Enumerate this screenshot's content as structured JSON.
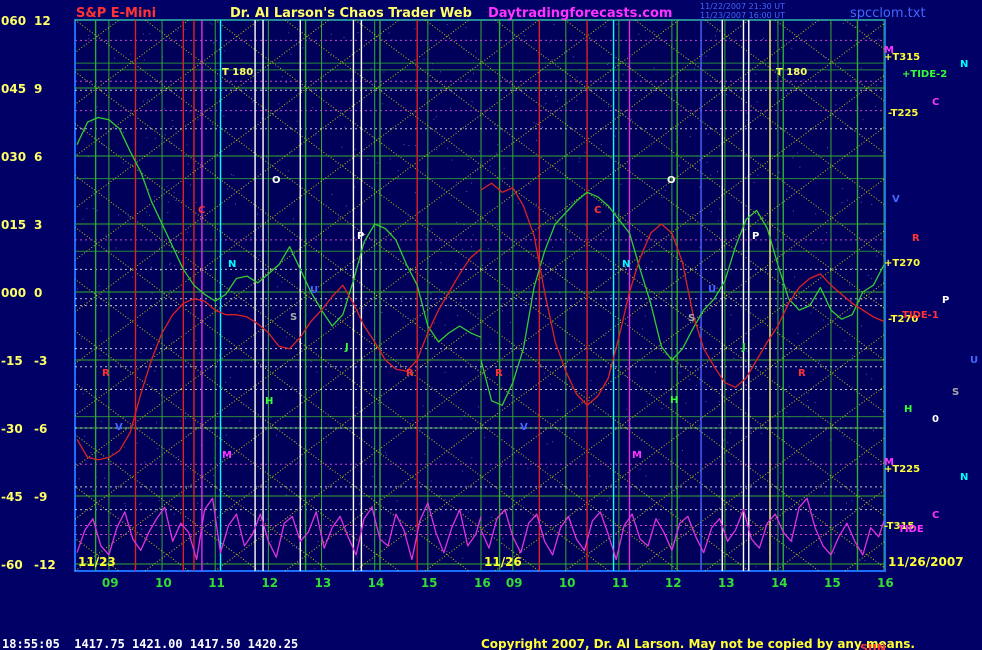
{
  "colors": {
    "background": "#000066",
    "plot_background": "#00005a",
    "frame": "#1a6cff",
    "grid_green": "#33aa33",
    "diagonal_yellow": "#e6e600",
    "dashed_white": "#ffffff",
    "dashed_magenta": "#cc44cc",
    "price_green": "#33cc33",
    "tide_red": "#dd2222",
    "tide_magenta": "#dd33dd",
    "header_red": "#ff3333",
    "header_yellow": "#ffff66",
    "header_magenta": "#ff33ff",
    "header_blue": "#4466ff",
    "footer_white": "#ffffff",
    "footer_yellow": "#ffff33"
  },
  "header": {
    "left_label": "S&P E-Mini",
    "title": "Dr. Al Larson's Chaos Trader Web",
    "site": "Daytradingforecasts.com",
    "file": "spcclom.txt",
    "stamp_line1": "11/22/2007 21:30 UT",
    "stamp_line2": "11/23/2007 16:00 UT"
  },
  "footer": {
    "quote": "18:55:05  1417.75 1421.00 1417.50 1420.25",
    "copyright": "Copyright 2007, Dr. Al Larson. May not be copied by any means.",
    "stray": "SUN"
  },
  "chart_data": {
    "type": "line",
    "title": "S&P E-Mini",
    "y_axis_left": {
      "degrees": [
        "060",
        "045",
        "030",
        "015",
        "000",
        "-15",
        "-30",
        "-45",
        "-60"
      ],
      "points": [
        "12",
        "9",
        "6",
        "3",
        "0",
        "-3",
        "-6",
        "-9",
        "-12"
      ],
      "range": [
        -12,
        12
      ]
    },
    "x_axis": {
      "ticks": [
        "09",
        "10",
        "11",
        "12",
        "13",
        "14",
        "15",
        "16",
        "09",
        "10",
        "11",
        "12",
        "13",
        "14",
        "15",
        "16"
      ],
      "session_labels": [
        "11/23",
        "11/26",
        "11/26/2007"
      ]
    },
    "right_labels": [
      {
        "text": "M",
        "color": "#ff33ff"
      },
      {
        "text": "+T315",
        "color": "#ffff33"
      },
      {
        "text": "N",
        "color": "#00ffff"
      },
      {
        "text": "+TIDE-2",
        "color": "#33ff33"
      },
      {
        "text": "C",
        "color": "#ff33ff"
      },
      {
        "text": "-T225",
        "color": "#ffff33"
      },
      {
        "text": "V",
        "color": "#4466ff"
      },
      {
        "text": "R",
        "color": "#ff3333"
      },
      {
        "text": "+T270",
        "color": "#ffff33"
      },
      {
        "text": "P",
        "color": "#ffffff"
      },
      {
        "text": "-T270",
        "color": "#ffff33"
      },
      {
        "text": "TIDE-1",
        "color": "#ff3333"
      },
      {
        "text": "U",
        "color": "#4466ff"
      },
      {
        "text": "S",
        "color": "#aaaaaa"
      },
      {
        "text": "H",
        "color": "#33ff33"
      },
      {
        "text": "0",
        "color": "#ffffff"
      },
      {
        "text": "M",
        "color": "#ff33ff"
      },
      {
        "text": "+T225",
        "color": "#ffff33"
      },
      {
        "text": "N",
        "color": "#00ffff"
      },
      {
        "text": "C",
        "color": "#ff33ff"
      },
      {
        "text": "-T315",
        "color": "#ffff33"
      },
      {
        "text": "TIDE",
        "color": "#ff33ff"
      }
    ],
    "plot_markers": [
      {
        "text": "T 180",
        "color": "#ffff66"
      },
      {
        "text": "T 180",
        "color": "#ffff66"
      },
      {
        "text": "O",
        "color": "#ffffff"
      },
      {
        "text": "O",
        "color": "#ffffff"
      },
      {
        "text": "C",
        "color": "#ff3333"
      },
      {
        "text": "C",
        "color": "#ff3333"
      },
      {
        "text": "N",
        "color": "#00ffff"
      },
      {
        "text": "N",
        "color": "#00ffff"
      },
      {
        "text": "P",
        "color": "#ffffff"
      },
      {
        "text": "P",
        "color": "#ffffff"
      },
      {
        "text": "S",
        "color": "#aaaaaa"
      },
      {
        "text": "S",
        "color": "#aaaaaa"
      },
      {
        "text": "R",
        "color": "#ff3333"
      },
      {
        "text": "R",
        "color": "#ff3333"
      },
      {
        "text": "R",
        "color": "#ff3333"
      },
      {
        "text": "R",
        "color": "#ff3333"
      },
      {
        "text": "H",
        "color": "#33ff33"
      },
      {
        "text": "H",
        "color": "#33ff33"
      },
      {
        "text": "M",
        "color": "#ff33ff"
      },
      {
        "text": "M",
        "color": "#ff33ff"
      },
      {
        "text": "U",
        "color": "#4466ff"
      },
      {
        "text": "U",
        "color": "#4466ff"
      },
      {
        "text": "V",
        "color": "#4466ff"
      },
      {
        "text": "V",
        "color": "#4466ff"
      },
      {
        "text": "J",
        "color": "#33ff33"
      },
      {
        "text": "J",
        "color": "#33ff33"
      }
    ],
    "session_starts": [
      8.4,
      8.4
    ],
    "vertical_lines": [
      {
        "x": 8.75,
        "color": "#33aa33",
        "session": 0
      },
      {
        "x": 9.5,
        "color": "#dd2222",
        "session": 0
      },
      {
        "x": 10.4,
        "color": "#dd2222",
        "session": 0
      },
      {
        "x": 10.6,
        "color": "#dd2222",
        "session": 0
      },
      {
        "x": 10.75,
        "color": "#dd33dd",
        "session": 0
      },
      {
        "x": 11.1,
        "color": "#00ffff",
        "session": 0
      },
      {
        "x": 11.75,
        "color": "#ffffff",
        "session": 0
      },
      {
        "x": 11.9,
        "color": "#ffffff",
        "session": 0
      },
      {
        "x": 12.6,
        "color": "#ffffff",
        "session": 0
      },
      {
        "x": 12.7,
        "color": "#33aa33",
        "session": 0
      },
      {
        "x": 13.6,
        "color": "#ffffff",
        "session": 0
      },
      {
        "x": 13.75,
        "color": "#ffffff",
        "session": 0
      },
      {
        "x": 14.1,
        "color": "#33aa33",
        "session": 0
      },
      {
        "x": 14.8,
        "color": "#dd2222",
        "session": 0
      },
      {
        "x": 8.75,
        "color": "#33aa33",
        "session": 1
      },
      {
        "x": 9.5,
        "color": "#dd2222",
        "session": 1
      },
      {
        "x": 10.4,
        "color": "#dd2222",
        "session": 1
      },
      {
        "x": 10.9,
        "color": "#00ffff",
        "session": 1
      },
      {
        "x": 11.2,
        "color": "#dd33dd",
        "session": 1
      },
      {
        "x": 12.1,
        "color": "#33aa33",
        "session": 1
      },
      {
        "x": 12.55,
        "color": "#4466ff",
        "session": 1
      },
      {
        "x": 12.95,
        "color": "#ffffff",
        "session": 1
      },
      {
        "x": 13.35,
        "color": "#ffffff",
        "session": 1
      },
      {
        "x": 13.45,
        "color": "#ffffff",
        "session": 1
      },
      {
        "x": 13.85,
        "color": "#ffff66",
        "session": 1
      },
      {
        "x": 14.1,
        "color": "#33aa33",
        "session": 1
      },
      {
        "x": 15.5,
        "color": "#33aa33",
        "session": 1
      }
    ],
    "hlines_white": [
      8.9,
      7.2,
      1.0,
      -0.3,
      -0.6,
      -2.5,
      -3.3,
      -4.3,
      -6.0,
      -8.6,
      -9.6
    ],
    "hlines_magenta": [
      11.1,
      9.3,
      8.0,
      2.3,
      -7.6,
      -10.3,
      -10.7
    ],
    "hlines_green": [
      10.1,
      9.8,
      5.0,
      1.8,
      -5.5
    ],
    "series": [
      {
        "name": "Price",
        "color": "#33cc33",
        "session": 0,
        "x": [
          8.4,
          8.6,
          8.8,
          9.0,
          9.2,
          9.4,
          9.6,
          9.8,
          10.0,
          10.2,
          10.4,
          10.6,
          10.8,
          11.0,
          11.2,
          11.4,
          11.6,
          11.8,
          12.0,
          12.2,
          12.4,
          12.6,
          12.8,
          13.0,
          13.2,
          13.4,
          13.6,
          13.8,
          14.0,
          14.2,
          14.4,
          14.6,
          14.8,
          15.0,
          15.2,
          15.4,
          15.6,
          15.8,
          16.0
        ],
        "y": [
          6.5,
          7.5,
          7.7,
          7.6,
          7.2,
          6.2,
          5.3,
          4.0,
          3.0,
          2.0,
          1.0,
          0.3,
          -0.1,
          -0.4,
          -0.1,
          0.6,
          0.7,
          0.4,
          0.8,
          1.2,
          2.0,
          1.0,
          0.0,
          -0.8,
          -1.5,
          -1.0,
          0.5,
          2.2,
          3.0,
          2.8,
          2.3,
          1.2,
          0.3,
          -1.5,
          -2.2,
          -1.8,
          -1.5,
          -1.8,
          -2.0
        ]
      },
      {
        "name": "Price",
        "color": "#33cc33",
        "session": 1,
        "x": [
          8.4,
          8.6,
          8.8,
          9.0,
          9.2,
          9.4,
          9.6,
          9.8,
          10.0,
          10.2,
          10.4,
          10.6,
          10.8,
          11.0,
          11.2,
          11.4,
          11.6,
          11.8,
          12.0,
          12.2,
          12.4,
          12.6,
          12.8,
          13.0,
          13.2,
          13.4,
          13.6,
          13.8,
          14.0,
          14.2,
          14.4,
          14.6,
          14.8,
          15.0,
          15.2,
          15.4,
          15.6,
          15.8,
          16.0
        ],
        "y": [
          -3.0,
          -4.8,
          -5.0,
          -4.0,
          -2.5,
          0.2,
          1.8,
          3.0,
          3.5,
          4.0,
          4.4,
          4.2,
          3.8,
          3.2,
          2.6,
          1.0,
          -0.5,
          -2.4,
          -3.0,
          -2.5,
          -1.6,
          -0.8,
          -0.3,
          0.5,
          2.0,
          3.2,
          3.6,
          2.8,
          1.2,
          -0.3,
          -0.8,
          -0.6,
          0.2,
          -0.8,
          -1.2,
          -1.0,
          0.0,
          0.3,
          1.2
        ]
      },
      {
        "name": "TIDE-1",
        "color": "#dd2222",
        "session": 0,
        "x": [
          8.4,
          8.6,
          8.8,
          9.0,
          9.2,
          9.4,
          9.6,
          9.8,
          10.0,
          10.2,
          10.4,
          10.6,
          10.8,
          11.0,
          11.2,
          11.4,
          11.6,
          11.8,
          12.0,
          12.2,
          12.4,
          12.6,
          12.8,
          13.0,
          13.2,
          13.4,
          13.6,
          13.8,
          14.0,
          14.2,
          14.4,
          14.6,
          14.8,
          15.0,
          15.2,
          15.4,
          15.6,
          15.8,
          16.0
        ],
        "y": [
          -6.5,
          -7.3,
          -7.4,
          -7.3,
          -7.0,
          -6.2,
          -4.5,
          -3.0,
          -1.8,
          -1.0,
          -0.5,
          -0.3,
          -0.4,
          -0.8,
          -1.0,
          -1.0,
          -1.1,
          -1.4,
          -1.8,
          -2.4,
          -2.5,
          -2.0,
          -1.3,
          -0.8,
          -0.2,
          0.3,
          -0.5,
          -1.5,
          -2.2,
          -3.0,
          -3.4,
          -3.5,
          -3.0,
          -1.8,
          -0.8,
          0.0,
          0.8,
          1.5,
          1.9
        ]
      },
      {
        "name": "TIDE-1",
        "color": "#dd2222",
        "session": 1,
        "x": [
          8.4,
          8.6,
          8.8,
          9.0,
          9.2,
          9.4,
          9.6,
          9.8,
          10.0,
          10.2,
          10.4,
          10.6,
          10.8,
          11.0,
          11.2,
          11.4,
          11.6,
          11.8,
          12.0,
          12.2,
          12.4,
          12.6,
          12.8,
          13.0,
          13.2,
          13.4,
          13.6,
          13.8,
          14.0,
          14.2,
          14.4,
          14.6,
          14.8,
          15.0,
          15.2,
          15.4,
          15.6,
          15.8,
          16.0
        ],
        "y": [
          4.5,
          4.8,
          4.4,
          4.6,
          3.8,
          2.5,
          0.0,
          -2.2,
          -3.5,
          -4.5,
          -5.0,
          -4.6,
          -3.8,
          -2.0,
          0.0,
          1.5,
          2.6,
          3.0,
          2.6,
          1.3,
          -1.0,
          -2.5,
          -3.3,
          -4.0,
          -4.2,
          -3.8,
          -3.0,
          -2.2,
          -1.5,
          -0.5,
          0.2,
          0.6,
          0.8,
          0.3,
          -0.1,
          -0.5,
          -0.8,
          -1.1,
          -1.3
        ]
      },
      {
        "name": "TIDE",
        "color": "#dd33dd",
        "session": 0,
        "x": [
          8.4,
          8.55,
          8.7,
          8.85,
          9.0,
          9.15,
          9.3,
          9.45,
          9.6,
          9.75,
          9.9,
          10.05,
          10.2,
          10.35,
          10.5,
          10.65,
          10.8,
          10.95,
          11.1,
          11.25,
          11.4,
          11.55,
          11.7,
          11.85,
          12.0,
          12.15,
          12.3,
          12.45,
          12.6,
          12.75,
          12.9,
          13.05,
          13.2,
          13.35,
          13.5,
          13.65,
          13.8,
          13.95,
          14.1,
          14.25,
          14.4,
          14.55,
          14.7,
          14.85,
          15.0,
          15.15,
          15.3,
          15.45,
          15.6,
          15.75,
          15.9,
          16.0
        ],
        "y": [
          -11.5,
          -10.5,
          -10.0,
          -11.2,
          -11.6,
          -10.4,
          -9.7,
          -10.9,
          -11.4,
          -10.6,
          -10.0,
          -9.5,
          -11.0,
          -10.2,
          -10.6,
          -11.8,
          -9.6,
          -9.1,
          -11.5,
          -10.3,
          -9.8,
          -11.2,
          -10.7,
          -9.8,
          -11.0,
          -11.7,
          -10.2,
          -9.9,
          -11.0,
          -10.6,
          -9.7,
          -11.3,
          -10.4,
          -9.9,
          -10.8,
          -11.6,
          -10.0,
          -9.5,
          -10.9,
          -11.2,
          -9.8,
          -10.5,
          -11.8,
          -10.1,
          -9.3,
          -10.6,
          -11.5,
          -10.4,
          -9.6,
          -11.2,
          -10.7,
          -9.9
        ]
      },
      {
        "name": "TIDE",
        "color": "#dd33dd",
        "session": 1,
        "x": [
          8.4,
          8.55,
          8.7,
          8.85,
          9.0,
          9.15,
          9.3,
          9.45,
          9.6,
          9.75,
          9.9,
          10.05,
          10.2,
          10.35,
          10.5,
          10.65,
          10.8,
          10.95,
          11.1,
          11.25,
          11.4,
          11.55,
          11.7,
          11.85,
          12.0,
          12.15,
          12.3,
          12.45,
          12.6,
          12.75,
          12.9,
          13.05,
          13.2,
          13.35,
          13.5,
          13.65,
          13.8,
          13.95,
          14.1,
          14.25,
          14.4,
          14.55,
          14.7,
          14.85,
          15.0,
          15.15,
          15.3,
          15.45,
          15.6,
          15.75,
          15.9,
          16.0
        ],
        "y": [
          -10.5,
          -11.3,
          -10.0,
          -9.6,
          -10.8,
          -11.5,
          -10.2,
          -9.8,
          -11.0,
          -11.6,
          -10.4,
          -9.9,
          -10.9,
          -11.4,
          -10.1,
          -9.7,
          -10.7,
          -11.8,
          -10.3,
          -9.8,
          -10.9,
          -11.2,
          -10.0,
          -10.6,
          -11.4,
          -10.2,
          -9.9,
          -10.8,
          -11.5,
          -10.4,
          -10.0,
          -11.0,
          -10.5,
          -9.6,
          -10.9,
          -11.3,
          -10.2,
          -9.8,
          -10.6,
          -11.0,
          -9.5,
          -9.1,
          -10.4,
          -11.2,
          -11.6,
          -10.8,
          -10.2,
          -11.0,
          -11.6,
          -10.4,
          -10.8,
          -10.1
        ]
      }
    ]
  }
}
